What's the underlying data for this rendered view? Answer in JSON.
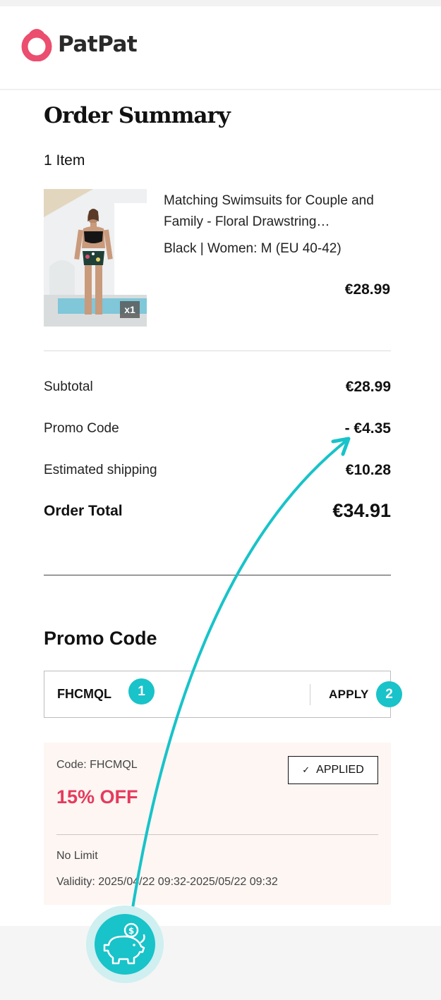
{
  "header": {
    "brand": "PatPat"
  },
  "summary": {
    "title": "Order Summary",
    "item_count": "1 Item",
    "product": {
      "name": "Matching Swimsuits for Couple and Family - Floral Drawstring…",
      "variant": "Black | Women: M (EU 40-42)",
      "price": "€28.99",
      "qty": "x1"
    },
    "rows": {
      "subtotal_label": "Subtotal",
      "subtotal_value": "€28.99",
      "promo_label": "Promo Code",
      "promo_value": "- €4.35",
      "shipping_label": "Estimated shipping",
      "shipping_value": "€10.28",
      "total_label": "Order Total",
      "total_value": "€34.91"
    }
  },
  "promo": {
    "heading": "Promo Code",
    "input_value": "FHCMQL",
    "apply_label": "APPLY",
    "step1": "1",
    "step2": "2",
    "coupon": {
      "code": "Code: FHCMQL",
      "discount": "15% OFF",
      "applied_label": "APPLIED",
      "limit": "No Limit",
      "validity": "Validity: 2025/04/22 09:32-2025/05/22 09:32"
    }
  },
  "colors": {
    "accent": "#18c3c9",
    "brand": "#eb4e6e",
    "discount": "#e63a5c",
    "coupon_bg": "#fdf6f3"
  },
  "icons": {
    "logo": "patpat-logo-icon",
    "check": "check-icon",
    "piggy": "piggy-bank-icon"
  }
}
